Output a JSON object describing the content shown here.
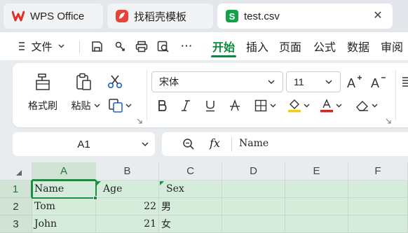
{
  "tabs": [
    {
      "label": "WPS Office"
    },
    {
      "label": "找稻壳模板"
    },
    {
      "label": "test.csv"
    }
  ],
  "menu": {
    "file_label": "文件",
    "ribbon_tabs": [
      "开始",
      "插入",
      "页面",
      "公式",
      "数据",
      "审阅"
    ],
    "more": "⋯"
  },
  "ribbon": {
    "format_painter": "格式刷",
    "paste": "粘贴",
    "font_name": "宋体",
    "font_size": "11"
  },
  "formula_bar": {
    "cell_ref": "A1",
    "fx_label": "fx",
    "content": "Name"
  },
  "sheet": {
    "columns": [
      "A",
      "B",
      "C",
      "D",
      "E",
      "F"
    ],
    "rows": [
      {
        "num": "1",
        "cells": [
          "Name",
          "Age",
          "Sex"
        ]
      },
      {
        "num": "2",
        "cells": [
          "Tom",
          "22",
          "男"
        ]
      },
      {
        "num": "3",
        "cells": [
          "John",
          "21",
          "女"
        ]
      }
    ]
  },
  "colors": {
    "accent_green": "#0b8a3d",
    "selection_green": "#d6ecda",
    "wps_red": "#e0302a",
    "text_red": "#d9261c",
    "highlight_yellow": "#f5d000"
  }
}
